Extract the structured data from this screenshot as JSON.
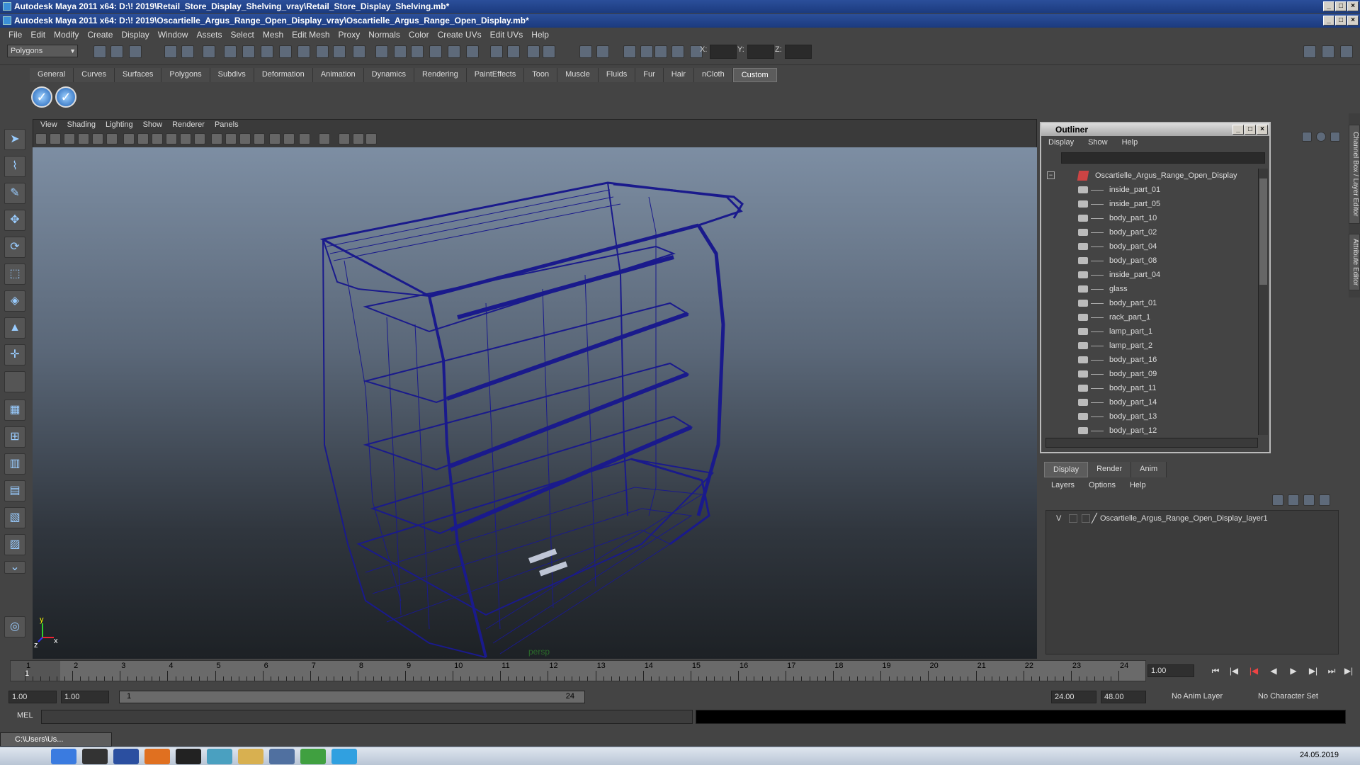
{
  "windows": {
    "back_title": "Autodesk Maya 2011 x64: D:\\! 2019\\Retail_Store_Display_Shelving_vray\\Retail_Store_Display_Shelving.mb*",
    "front_title": "Autodesk Maya 2011 x64: D:\\! 2019\\Oscartielle_Argus_Range_Open_Display_vray\\Oscartielle_Argus_Range_Open_Display.mb*"
  },
  "menubar": [
    "File",
    "Edit",
    "Modify",
    "Create",
    "Display",
    "Window",
    "Assets",
    "Select",
    "Mesh",
    "Edit Mesh",
    "Proxy",
    "Normals",
    "Color",
    "Create UVs",
    "Edit UVs",
    "Help"
  ],
  "toolbar": {
    "mode": "Polygons",
    "x_label": "X:",
    "y_label": "Y:",
    "z_label": "Z:"
  },
  "shelf_tabs": [
    "General",
    "Curves",
    "Surfaces",
    "Polygons",
    "Subdivs",
    "Deformation",
    "Animation",
    "Dynamics",
    "Rendering",
    "PaintEffects",
    "Toon",
    "Muscle",
    "Fluids",
    "Fur",
    "Hair",
    "nCloth",
    "Custom"
  ],
  "active_shelf_tab": "Custom",
  "viewport": {
    "menu": [
      "View",
      "Shading",
      "Lighting",
      "Show",
      "Renderer",
      "Panels"
    ],
    "camera_label": "persp",
    "axis_y": "y",
    "axis_x": "x",
    "axis_z": "z"
  },
  "outliner": {
    "title": "Outliner",
    "menu": [
      "Display",
      "Show",
      "Help"
    ],
    "root": "Oscartielle_Argus_Range_Open_Display",
    "items": [
      "inside_part_01",
      "inside_part_05",
      "body_part_10",
      "body_part_02",
      "body_part_04",
      "body_part_08",
      "inside_part_04",
      "glass",
      "body_part_01",
      "rack_part_1",
      "lamp_part_1",
      "lamp_part_2",
      "body_part_16",
      "body_part_09",
      "body_part_11",
      "body_part_14",
      "body_part_13",
      "body_part_12"
    ]
  },
  "side_tabs": [
    "Channel Box / Layer Editor",
    "Attribute Editor"
  ],
  "layer_editor": {
    "tabs": [
      "Display",
      "Render",
      "Anim"
    ],
    "active_tab": "Display",
    "menu": [
      "Layers",
      "Options",
      "Help"
    ],
    "layer_visibility": "V",
    "layer_name": "Oscartielle_Argus_Range_Open_Display_layer1"
  },
  "timeline": {
    "ticks": [
      "1",
      "2",
      "3",
      "4",
      "5",
      "6",
      "7",
      "8",
      "9",
      "10",
      "11",
      "12",
      "13",
      "14",
      "15",
      "16",
      "17",
      "18",
      "19",
      "20",
      "21",
      "22",
      "23",
      "24"
    ],
    "current_frame_marker": "1",
    "current_time": "1.00"
  },
  "range": {
    "start": "1.00",
    "playback_start": "1.00",
    "slider_start": "1",
    "slider_end": "24",
    "playback_end": "24.00",
    "end": "48.00",
    "anim_layer": "No Anim Layer",
    "character_set": "No Character Set"
  },
  "command_line": {
    "label": "MEL"
  },
  "taskbar": {
    "minimized_window": "C:\\Users\\Us...",
    "clock": "24.05.2019"
  },
  "colors": {
    "wireframe": "#1a1a8c",
    "title_bar": "#1b3a7e",
    "ui_bg": "#444444"
  }
}
